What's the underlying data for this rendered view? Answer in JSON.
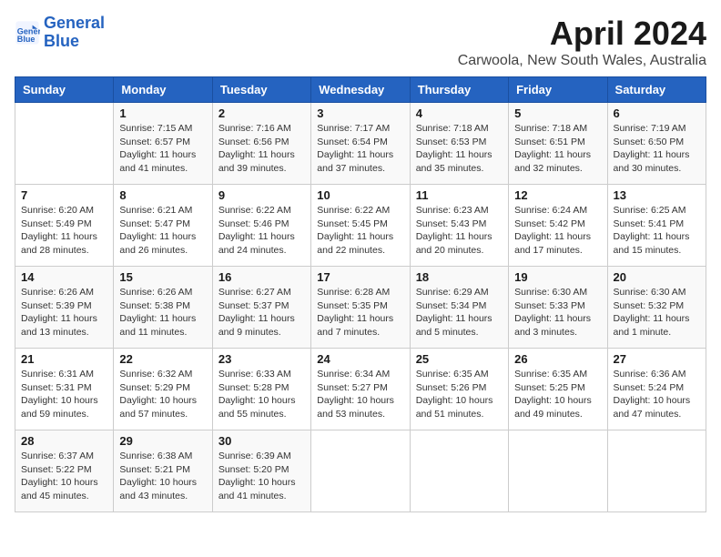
{
  "header": {
    "logo_line1": "General",
    "logo_line2": "Blue",
    "month": "April 2024",
    "location": "Carwoola, New South Wales, Australia"
  },
  "days_of_week": [
    "Sunday",
    "Monday",
    "Tuesday",
    "Wednesday",
    "Thursday",
    "Friday",
    "Saturday"
  ],
  "weeks": [
    [
      {
        "day": "",
        "info": ""
      },
      {
        "day": "1",
        "info": "Sunrise: 7:15 AM\nSunset: 6:57 PM\nDaylight: 11 hours\nand 41 minutes."
      },
      {
        "day": "2",
        "info": "Sunrise: 7:16 AM\nSunset: 6:56 PM\nDaylight: 11 hours\nand 39 minutes."
      },
      {
        "day": "3",
        "info": "Sunrise: 7:17 AM\nSunset: 6:54 PM\nDaylight: 11 hours\nand 37 minutes."
      },
      {
        "day": "4",
        "info": "Sunrise: 7:18 AM\nSunset: 6:53 PM\nDaylight: 11 hours\nand 35 minutes."
      },
      {
        "day": "5",
        "info": "Sunrise: 7:18 AM\nSunset: 6:51 PM\nDaylight: 11 hours\nand 32 minutes."
      },
      {
        "day": "6",
        "info": "Sunrise: 7:19 AM\nSunset: 6:50 PM\nDaylight: 11 hours\nand 30 minutes."
      }
    ],
    [
      {
        "day": "7",
        "info": "Sunrise: 6:20 AM\nSunset: 5:49 PM\nDaylight: 11 hours\nand 28 minutes."
      },
      {
        "day": "8",
        "info": "Sunrise: 6:21 AM\nSunset: 5:47 PM\nDaylight: 11 hours\nand 26 minutes."
      },
      {
        "day": "9",
        "info": "Sunrise: 6:22 AM\nSunset: 5:46 PM\nDaylight: 11 hours\nand 24 minutes."
      },
      {
        "day": "10",
        "info": "Sunrise: 6:22 AM\nSunset: 5:45 PM\nDaylight: 11 hours\nand 22 minutes."
      },
      {
        "day": "11",
        "info": "Sunrise: 6:23 AM\nSunset: 5:43 PM\nDaylight: 11 hours\nand 20 minutes."
      },
      {
        "day": "12",
        "info": "Sunrise: 6:24 AM\nSunset: 5:42 PM\nDaylight: 11 hours\nand 17 minutes."
      },
      {
        "day": "13",
        "info": "Sunrise: 6:25 AM\nSunset: 5:41 PM\nDaylight: 11 hours\nand 15 minutes."
      }
    ],
    [
      {
        "day": "14",
        "info": "Sunrise: 6:26 AM\nSunset: 5:39 PM\nDaylight: 11 hours\nand 13 minutes."
      },
      {
        "day": "15",
        "info": "Sunrise: 6:26 AM\nSunset: 5:38 PM\nDaylight: 11 hours\nand 11 minutes."
      },
      {
        "day": "16",
        "info": "Sunrise: 6:27 AM\nSunset: 5:37 PM\nDaylight: 11 hours\nand 9 minutes."
      },
      {
        "day": "17",
        "info": "Sunrise: 6:28 AM\nSunset: 5:35 PM\nDaylight: 11 hours\nand 7 minutes."
      },
      {
        "day": "18",
        "info": "Sunrise: 6:29 AM\nSunset: 5:34 PM\nDaylight: 11 hours\nand 5 minutes."
      },
      {
        "day": "19",
        "info": "Sunrise: 6:30 AM\nSunset: 5:33 PM\nDaylight: 11 hours\nand 3 minutes."
      },
      {
        "day": "20",
        "info": "Sunrise: 6:30 AM\nSunset: 5:32 PM\nDaylight: 11 hours\nand 1 minute."
      }
    ],
    [
      {
        "day": "21",
        "info": "Sunrise: 6:31 AM\nSunset: 5:31 PM\nDaylight: 10 hours\nand 59 minutes."
      },
      {
        "day": "22",
        "info": "Sunrise: 6:32 AM\nSunset: 5:29 PM\nDaylight: 10 hours\nand 57 minutes."
      },
      {
        "day": "23",
        "info": "Sunrise: 6:33 AM\nSunset: 5:28 PM\nDaylight: 10 hours\nand 55 minutes."
      },
      {
        "day": "24",
        "info": "Sunrise: 6:34 AM\nSunset: 5:27 PM\nDaylight: 10 hours\nand 53 minutes."
      },
      {
        "day": "25",
        "info": "Sunrise: 6:35 AM\nSunset: 5:26 PM\nDaylight: 10 hours\nand 51 minutes."
      },
      {
        "day": "26",
        "info": "Sunrise: 6:35 AM\nSunset: 5:25 PM\nDaylight: 10 hours\nand 49 minutes."
      },
      {
        "day": "27",
        "info": "Sunrise: 6:36 AM\nSunset: 5:24 PM\nDaylight: 10 hours\nand 47 minutes."
      }
    ],
    [
      {
        "day": "28",
        "info": "Sunrise: 6:37 AM\nSunset: 5:22 PM\nDaylight: 10 hours\nand 45 minutes."
      },
      {
        "day": "29",
        "info": "Sunrise: 6:38 AM\nSunset: 5:21 PM\nDaylight: 10 hours\nand 43 minutes."
      },
      {
        "day": "30",
        "info": "Sunrise: 6:39 AM\nSunset: 5:20 PM\nDaylight: 10 hours\nand 41 minutes."
      },
      {
        "day": "",
        "info": ""
      },
      {
        "day": "",
        "info": ""
      },
      {
        "day": "",
        "info": ""
      },
      {
        "day": "",
        "info": ""
      }
    ]
  ]
}
